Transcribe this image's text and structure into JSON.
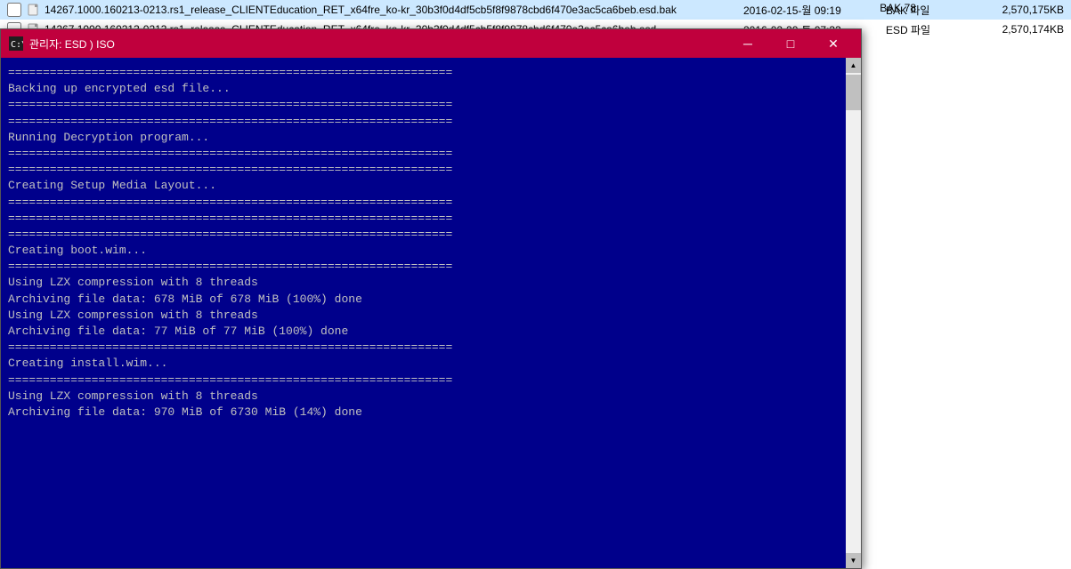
{
  "explorer": {
    "files": [
      {
        "name": "14267.1000.160213-0213.rs1_release_CLIENTEducation_RET_x64fre_ko-kr_30b3f0d4df5cb5f8f9878cbd6f470e3ac5ca6beb.esd.bak",
        "date": "2016-02-15-월 09:19",
        "type": "BAK 파일",
        "size": "2,570,175KB"
      },
      {
        "name": "14267.1000.160213-0213.rs1_release_CLIENTEducation_RET_x64fre_ko-kr_30b3f0d4df5cb5f8f9878cbd6f470e3ac5ca6beb.esd",
        "date": "2016-02-20-토 07:33",
        "type": "ESD 파일",
        "size": "2,570,174KB"
      }
    ]
  },
  "bak_label": "BAK 78",
  "terminal": {
    "title": "관리자: ESD ) ISO",
    "icon": "cmd",
    "lines": [
      "================================================================",
      "Backing up encrypted esd file...",
      "================================================================",
      "",
      "================================================================",
      "Running Decryption program...",
      "================================================================",
      "",
      "================================================================",
      "Creating Setup Media Layout...",
      "================================================================",
      "",
      "================================================================",
      "",
      "================================================================",
      "Creating boot.wim...",
      "================================================================",
      "",
      "Using LZX compression with 8 threads",
      "Archiving file data: 678 MiB of 678 MiB (100%) done",
      "",
      "Using LZX compression with 8 threads",
      "Archiving file data: 77 MiB of 77 MiB (100%) done",
      "",
      "================================================================",
      "Creating install.wim...",
      "================================================================",
      "",
      "Using LZX compression with 8 threads",
      "Archiving file data: 970 MiB of 6730 MiB (14%) done"
    ],
    "controls": {
      "minimize": "─",
      "maximize": "□",
      "close": "✕"
    }
  }
}
